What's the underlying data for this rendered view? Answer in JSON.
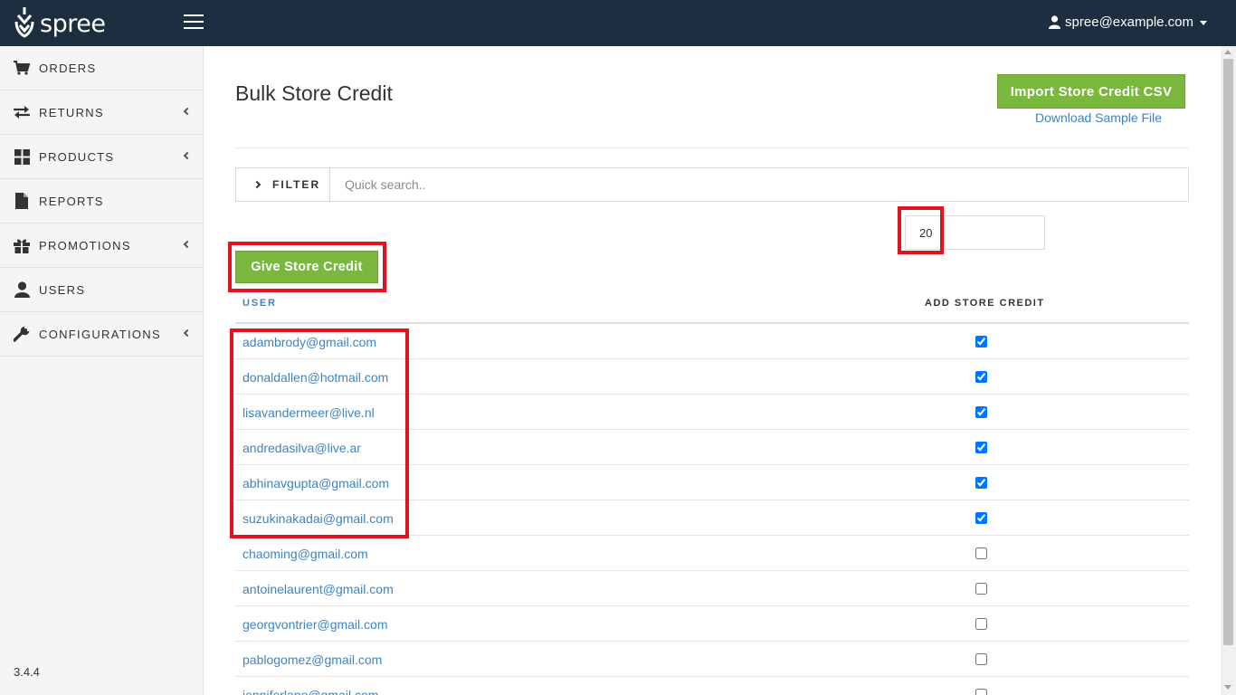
{
  "header": {
    "logo_text": "spree",
    "user_email": "spree@example.com"
  },
  "sidebar": {
    "items": [
      {
        "label": "ORDERS",
        "icon": "cart-icon",
        "has_submenu": false
      },
      {
        "label": "RETURNS",
        "icon": "arrows-exchange-icon",
        "has_submenu": true
      },
      {
        "label": "PRODUCTS",
        "icon": "grid-icon",
        "has_submenu": true
      },
      {
        "label": "REPORTS",
        "icon": "file-icon",
        "has_submenu": false
      },
      {
        "label": "PROMOTIONS",
        "icon": "gift-icon",
        "has_submenu": true
      },
      {
        "label": "USERS",
        "icon": "user-icon",
        "has_submenu": false
      },
      {
        "label": "CONFIGURATIONS",
        "icon": "wrench-icon",
        "has_submenu": true
      }
    ],
    "version": "3.4.4"
  },
  "main": {
    "title": "Bulk Store Credit",
    "import_button": "Import Store Credit CSV",
    "download_link": "Download Sample File",
    "filter": {
      "label": "FILTER",
      "placeholder": "Quick search.."
    },
    "amount_value": "20",
    "give_button": "Give Store Credit",
    "table": {
      "columns": [
        "USER",
        "ADD STORE CREDIT"
      ],
      "rows": [
        {
          "email": "adambrody@gmail.com",
          "checked": true
        },
        {
          "email": "donaldallen@hotmail.com",
          "checked": true
        },
        {
          "email": "lisavandermeer@live.nl",
          "checked": true
        },
        {
          "email": "andredasilva@live.ar",
          "checked": true
        },
        {
          "email": "abhinavgupta@gmail.com",
          "checked": true
        },
        {
          "email": "suzukinakadai@gmail.com",
          "checked": true
        },
        {
          "email": "chaoming@gmail.com",
          "checked": false
        },
        {
          "email": "antoinelaurent@gmail.com",
          "checked": false
        },
        {
          "email": "georgvontrier@gmail.com",
          "checked": false
        },
        {
          "email": "pablogomez@gmail.com",
          "checked": false
        },
        {
          "email": "jenniferlane@gmail.com",
          "checked": false
        }
      ]
    }
  },
  "colors": {
    "topbar": "#1c2e40",
    "accent_green": "#79b83c",
    "link_blue": "#3f83bf",
    "highlight_red": "#e0141e"
  }
}
